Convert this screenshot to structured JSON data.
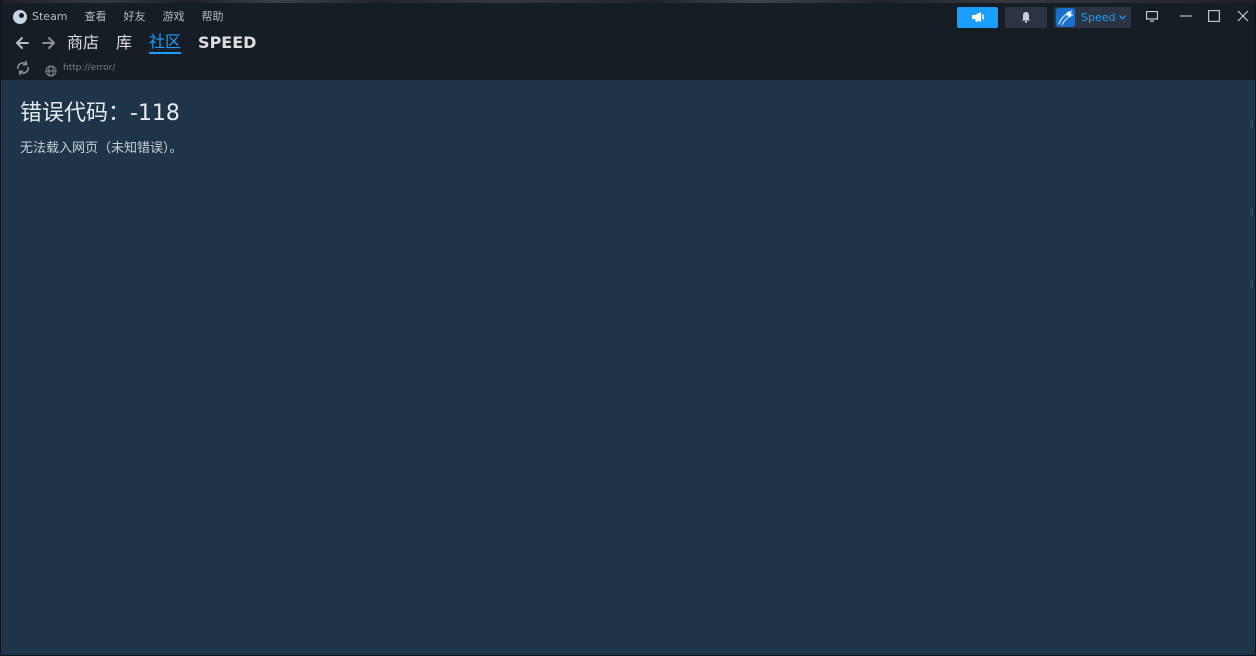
{
  "menu": {
    "app": "Steam",
    "items": [
      "查看",
      "好友",
      "游戏",
      "帮助"
    ]
  },
  "nav": {
    "links": [
      {
        "label": "商店",
        "active": false
      },
      {
        "label": "库",
        "active": false
      },
      {
        "label": "社区",
        "active": true
      }
    ],
    "user_link": "SPEED"
  },
  "address": {
    "url": "http://error/"
  },
  "account": {
    "name": "Speed"
  },
  "icons": {
    "back": "back-arrow-icon",
    "forward": "forward-arrow-icon",
    "reload": "reload-icon",
    "globe": "globe-icon",
    "announce": "megaphone-icon",
    "notifications": "bell-icon",
    "big_picture": "monitor-icon",
    "minimize": "minimize-icon",
    "maximize": "maximize-icon",
    "close": "close-icon"
  },
  "colors": {
    "accent": "#1a9fff",
    "header_bg": "#171d25",
    "content_bg": "#1e3549"
  },
  "error": {
    "title": "错误代码：-118",
    "message": "无法载入网页（未知错误）。"
  }
}
